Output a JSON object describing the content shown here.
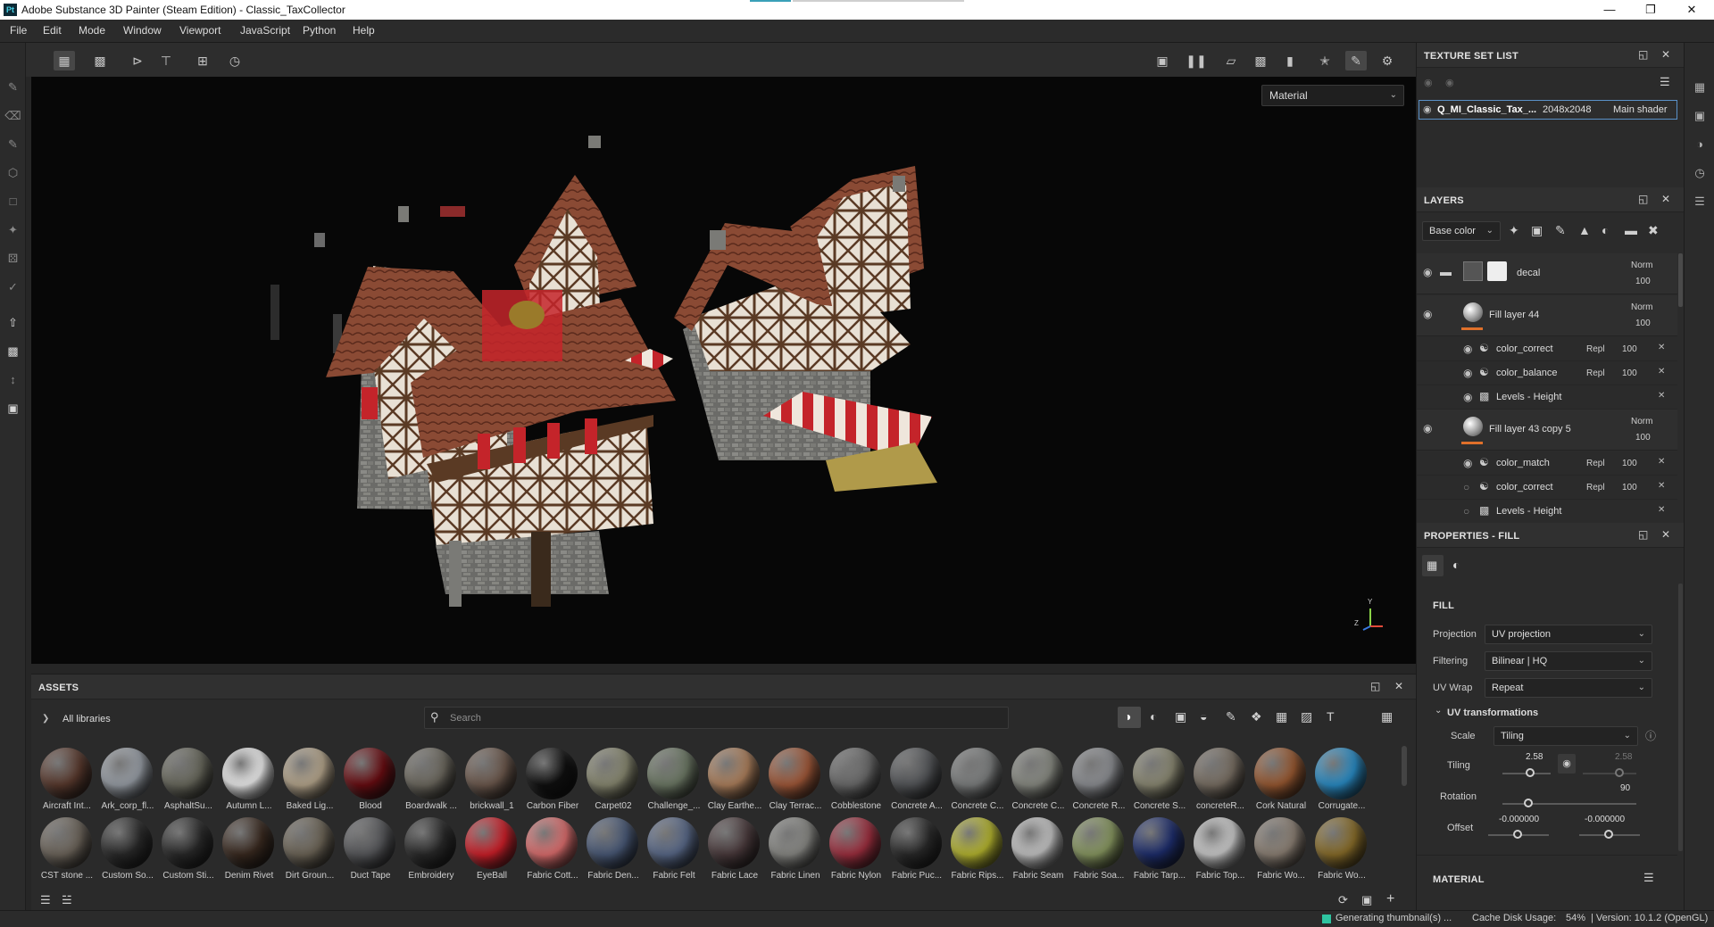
{
  "window": {
    "app_icon": "Pt",
    "title": "Adobe Substance 3D Painter (Steam Edition) - Classic_TaxCollector",
    "controls": [
      "minimize-icon",
      "restore-icon",
      "close-icon"
    ]
  },
  "menu": [
    "File",
    "Edit",
    "Mode",
    "Window",
    "Viewport",
    "JavaScript",
    "Python",
    "Help"
  ],
  "viewport": {
    "mode_select": "Material",
    "axis": {
      "y": "Y",
      "z": "Z"
    }
  },
  "assets": {
    "title": "ASSETS",
    "breadcrumb": "All libraries",
    "search_placeholder": "Search",
    "row1": [
      {
        "label": "Aircraft Int...",
        "color": "#5a3a2e"
      },
      {
        "label": "Ark_corp_fl...",
        "color": "#9aa0a8"
      },
      {
        "label": "AsphaltSu...",
        "color": "#6a6a5e"
      },
      {
        "label": "Autumn L...",
        "color": "#f2f2f2"
      },
      {
        "label": "Baked Lig...",
        "color": "#b8a88e"
      },
      {
        "label": "Blood",
        "color": "#6a0d12"
      },
      {
        "label": "Boardwalk ...",
        "color": "#6e6a60"
      },
      {
        "label": "brickwall_1",
        "color": "#6e5a4e"
      },
      {
        "label": "Carbon Fiber",
        "color": "#101010"
      },
      {
        "label": "Carpet02",
        "color": "#8a8a72"
      },
      {
        "label": "Challenge_...",
        "color": "#6e7a66"
      },
      {
        "label": "Clay Earthe...",
        "color": "#b0825e"
      },
      {
        "label": "Clay Terrac...",
        "color": "#a35a3a"
      },
      {
        "label": "Cobblestone",
        "color": "#6c6c6c"
      },
      {
        "label": "Concrete A...",
        "color": "#55575a"
      },
      {
        "label": "Concrete C...",
        "color": "#7e8080"
      },
      {
        "label": "Concrete C...",
        "color": "#8a8c84"
      },
      {
        "label": "Concrete R...",
        "color": "#8e9094"
      },
      {
        "label": "Concrete S...",
        "color": "#8c8a74"
      },
      {
        "label": "concreteR...",
        "color": "#7a7064"
      },
      {
        "label": "Cork Natural",
        "color": "#9a5a32"
      },
      {
        "label": "Corrugate...",
        "color": "#2a8ec8"
      }
    ],
    "row2": [
      {
        "label": "CST stone ...",
        "color": "#6e665c"
      },
      {
        "label": "Custom So...",
        "color": "#2a2a2a"
      },
      {
        "label": "Custom Sti...",
        "color": "#2a2a2a"
      },
      {
        "label": "Denim Rivet",
        "color": "#3a2a20"
      },
      {
        "label": "Dirt Groun...",
        "color": "#6e6658"
      },
      {
        "label": "Duct Tape",
        "color": "#58595c"
      },
      {
        "label": "Embroidery",
        "color": "#2a2a2a"
      },
      {
        "label": "EyeBall",
        "color": "#d0202a"
      },
      {
        "label": "Fabric Cott...",
        "color": "#e07070"
      },
      {
        "label": "Fabric Den...",
        "color": "#4a5a78"
      },
      {
        "label": "Fabric Felt",
        "color": "#5a6a8a"
      },
      {
        "label": "Fabric Lace",
        "color": "#4a3a3c"
      },
      {
        "label": "Fabric Linen",
        "color": "#8a8a86"
      },
      {
        "label": "Fabric Nylon",
        "color": "#a03040"
      },
      {
        "label": "Fabric Puc...",
        "color": "#2a2a2a"
      },
      {
        "label": "Fabric Rips...",
        "color": "#b8b830"
      },
      {
        "label": "Fabric Seam",
        "color": "#c8c8c8"
      },
      {
        "label": "Fabric Soa...",
        "color": "#8a9a62"
      },
      {
        "label": "Fabric Tarp...",
        "color": "#1e2e6e"
      },
      {
        "label": "Fabric Top...",
        "color": "#cfcfcf"
      },
      {
        "label": "Fabric Wo...",
        "color": "#8e8276"
      },
      {
        "label": "Fabric Wo...",
        "color": "#8a6e2a"
      }
    ]
  },
  "texture_set": {
    "title": "TEXTURE SET LIST",
    "name": "Q_MI_Classic_Tax_...",
    "resolution": "2048x2048",
    "shader": "Main shader"
  },
  "layers": {
    "title": "LAYERS",
    "channel": "Base color",
    "items": [
      {
        "name": "decal",
        "blend": "Norm",
        "opacity": "100",
        "type": "folder"
      },
      {
        "name": "Fill layer 44",
        "blend": "Norm",
        "opacity": "100",
        "type": "fill",
        "effects": [
          {
            "name": "color_correct",
            "blend": "Repl",
            "opacity": "100",
            "visible": true
          },
          {
            "name": "color_balance",
            "blend": "Repl",
            "opacity": "100",
            "visible": true
          },
          {
            "name": "Levels - Height",
            "blend": "",
            "opacity": "",
            "visible": true
          }
        ]
      },
      {
        "name": "Fill layer 43 copy 5",
        "blend": "Norm",
        "opacity": "100",
        "type": "fill",
        "effects": [
          {
            "name": "color_match",
            "blend": "Repl",
            "opacity": "100",
            "visible": true
          },
          {
            "name": "color_correct",
            "blend": "Repl",
            "opacity": "100",
            "visible": false
          },
          {
            "name": "Levels - Height",
            "blend": "",
            "opacity": "",
            "visible": false
          }
        ]
      }
    ]
  },
  "properties": {
    "title": "PROPERTIES - FILL",
    "section": "FILL",
    "projection_label": "Projection",
    "projection": "UV projection",
    "filtering_label": "Filtering",
    "filtering": "Bilinear | HQ",
    "uvwrap_label": "UV Wrap",
    "uvwrap": "Repeat",
    "uvtrans_title": "UV transformations",
    "scale_label": "Scale",
    "scale": "Tiling",
    "tiling_label": "Tiling",
    "tiling_u": "2.58",
    "tiling_v": "2.58",
    "rotation_label": "Rotation",
    "rotation": "90",
    "offset_label": "Offset",
    "offset_u": "-0.000000",
    "offset_v": "-0.000000",
    "material_title": "MATERIAL"
  },
  "status": {
    "generating": "Generating thumbnail(s) ...",
    "cache": "Cache Disk Usage:",
    "cache_value": "54%",
    "version": "| Version: 10.1.2 (OpenGL)"
  }
}
